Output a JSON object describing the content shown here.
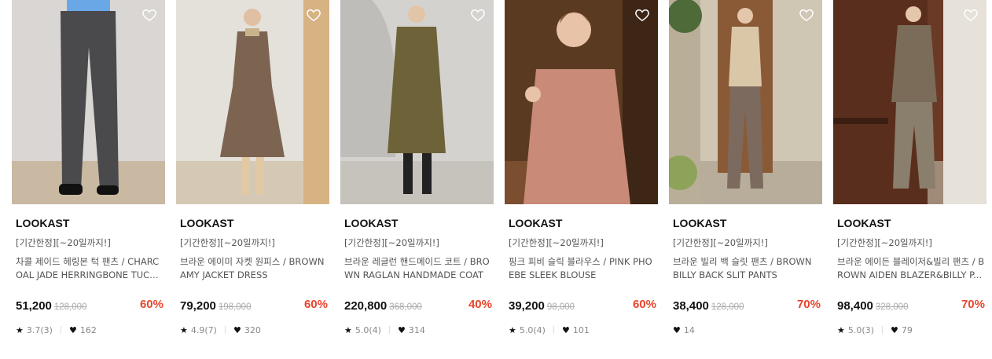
{
  "products": [
    {
      "brand": "LOOKAST",
      "tag": "[기간한정][~20일까지!]",
      "name": "차콜 제이드 헤링본 턱 팬츠 / CHARCOAL JADE HERRINGBONE TUCK ...",
      "price": "51,200",
      "original_price": "128,000",
      "discount": "60%",
      "rating": "3.7(3)",
      "likes": "162",
      "icon": "heart-outline-icon",
      "colors": {
        "bg": "#d9d6d3",
        "floor": "#c9b9a3",
        "garment": "#4a4a4c",
        "top": "#6aa7e6"
      }
    },
    {
      "brand": "LOOKAST",
      "tag": "[기간한정][~20일까지!]",
      "name": "브라운 에이미 자켓 원피스 / BROWN AMY JACKET DRESS",
      "price": "79,200",
      "original_price": "198,000",
      "discount": "60%",
      "rating": "4.9(7)",
      "likes": "320",
      "icon": "heart-outline-icon",
      "colors": {
        "bg": "#e4e0da",
        "floor": "#d5c8b5",
        "garment": "#7c6450",
        "top": "#c9b38a"
      }
    },
    {
      "brand": "LOOKAST",
      "tag": "[기간한정][~20일까지!]",
      "name": "브라운 레글런 핸드메이드 코트 / BROWN RAGLAN HANDMADE COAT",
      "price": "220,800",
      "original_price": "368,000",
      "discount": "40%",
      "rating": "5.0(4)",
      "likes": "314",
      "icon": "heart-outline-icon",
      "colors": {
        "bg": "#d4d2cf",
        "floor": "#c6c2bc",
        "garment": "#6e6238",
        "top": "#222"
      }
    },
    {
      "brand": "LOOKAST",
      "tag": "[기간한정][~20일까지!]",
      "name": "핑크 피비 슬릭 블라우스 / PINK PHOEBE SLEEK BLOUSE",
      "price": "39,200",
      "original_price": "98,000",
      "discount": "60%",
      "rating": "5.0(4)",
      "likes": "101",
      "icon": "heart-outline-icon",
      "colors": {
        "bg": "#5b3a22",
        "floor": "#7a4e2e",
        "garment": "#c98a78",
        "top": "#e8c3a8"
      }
    },
    {
      "brand": "LOOKAST",
      "tag": "[기간한정][~20일까지!]",
      "name": "브라운 빌리 백 슬릿 팬츠 / BROWN BILLY BACK SLIT PANTS",
      "price": "38,400",
      "original_price": "128,000",
      "discount": "70%",
      "rating": "",
      "likes": "14",
      "icon": "heart-outline-icon",
      "colors": {
        "bg": "#cfc6b4",
        "floor": "#b8ad9a",
        "garment": "#7d6a5e",
        "top": "#d9c7a8"
      }
    },
    {
      "brand": "LOOKAST",
      "tag": "[기간한정][~20일까지!]",
      "name": "브라운 에이든 블레이저&빌리 팬츠 / BROWN AIDEN BLAZER&BILLY P...",
      "price": "98,400",
      "original_price": "328,000",
      "discount": "70%",
      "rating": "5.0(3)",
      "likes": "79",
      "icon": "heart-outline-icon",
      "colors": {
        "bg": "#6b3a26",
        "floor": "#a08a78",
        "garment": "#8a7e6c",
        "top": "#7a6c58"
      }
    }
  ]
}
